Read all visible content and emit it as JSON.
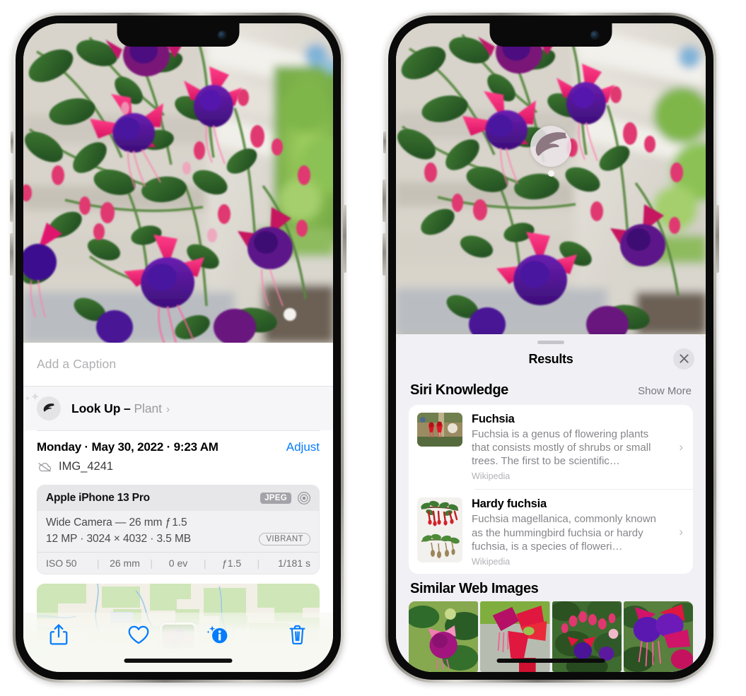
{
  "left_phone": {
    "caption_field": {
      "placeholder": "Add a Caption",
      "value": ""
    },
    "lookup": {
      "icon": "leaf-icon",
      "label": "Look Up",
      "dash": " – ",
      "subject": "Plant",
      "chevron": "›"
    },
    "metadata": {
      "date_line": "Monday · May 30, 2022 · 9:23 AM",
      "adjust_label": "Adjust",
      "cloud_icon": "cloud-slash-icon",
      "filename": "IMG_4241"
    },
    "exif": {
      "device": "Apple iPhone 13 Pro",
      "format_badge": "JPEG",
      "raw_icon": "aperture-icon",
      "lens_line": "Wide Camera — 26 mm ƒ 1.5",
      "size_line": "12 MP · 3024 × 4032 · 3.5 MB",
      "style_badge": "VIBRANT",
      "stats": [
        "ISO 50",
        "26 mm",
        "0 ev",
        "ƒ1.5",
        "1/181 s"
      ],
      "stat_separator": "|"
    },
    "map": {
      "name": "location-map-thumbnail"
    },
    "toolbar": [
      {
        "name": "share-button",
        "icon": "share-icon",
        "color": "#067cfd"
      },
      {
        "name": "favorite-button",
        "icon": "heart-icon",
        "color": "#067cfd"
      },
      {
        "name": "info-button",
        "icon": "info-sparkle-icon",
        "color": "#067cfd"
      },
      {
        "name": "delete-button",
        "icon": "trash-icon",
        "color": "#067cfd"
      }
    ]
  },
  "right_phone": {
    "visual_lookup_badge": {
      "icon": "leaf-icon",
      "name": "visual-look-up-badge"
    },
    "sheet": {
      "title": "Results",
      "close_icon": "close-icon",
      "grabber": "drag-handle"
    },
    "siri_knowledge": {
      "section_title": "Siri Knowledge",
      "show_more": "Show More",
      "items": [
        {
          "title": "Fuchsia",
          "description": "Fuchsia is a genus of flowering plants that consists mostly of shrubs or small trees. The first to be scientific…",
          "source": "Wikipedia",
          "thumbnail": "fuchsia-red-flowers-thumbnail",
          "chevron": "›"
        },
        {
          "title": "Hardy fuchsia",
          "description": "Fuchsia magellanica, commonly known as the hummingbird fuchsia or hardy fuchsia, is a species of floweri…",
          "source": "Wikipedia",
          "thumbnail": "hardy-fuchsia-specimen-thumbnail",
          "chevron": "›"
        }
      ]
    },
    "similar_web_images": {
      "section_title": "Similar Web Images",
      "tiles": [
        "fuchsia-pink-white-flower",
        "fuchsia-red-closeup",
        "fuchsia-bush-buds",
        "fuchsia-purple-magenta"
      ]
    }
  },
  "colors": {
    "accent_blue": "#067cfd",
    "sheet_bg": "#f1f0f5",
    "card_white": "#ffffff",
    "secondary_text": "#86868b"
  }
}
